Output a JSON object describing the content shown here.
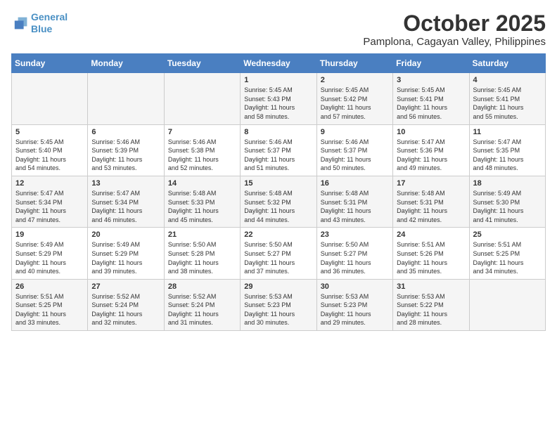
{
  "logo": {
    "line1": "General",
    "line2": "Blue"
  },
  "title": "October 2025",
  "location": "Pamplona, Cagayan Valley, Philippines",
  "weekdays": [
    "Sunday",
    "Monday",
    "Tuesday",
    "Wednesday",
    "Thursday",
    "Friday",
    "Saturday"
  ],
  "weeks": [
    [
      {
        "day": "",
        "info": ""
      },
      {
        "day": "",
        "info": ""
      },
      {
        "day": "",
        "info": ""
      },
      {
        "day": "1",
        "info": "Sunrise: 5:45 AM\nSunset: 5:43 PM\nDaylight: 11 hours\nand 58 minutes."
      },
      {
        "day": "2",
        "info": "Sunrise: 5:45 AM\nSunset: 5:42 PM\nDaylight: 11 hours\nand 57 minutes."
      },
      {
        "day": "3",
        "info": "Sunrise: 5:45 AM\nSunset: 5:41 PM\nDaylight: 11 hours\nand 56 minutes."
      },
      {
        "day": "4",
        "info": "Sunrise: 5:45 AM\nSunset: 5:41 PM\nDaylight: 11 hours\nand 55 minutes."
      }
    ],
    [
      {
        "day": "5",
        "info": "Sunrise: 5:45 AM\nSunset: 5:40 PM\nDaylight: 11 hours\nand 54 minutes."
      },
      {
        "day": "6",
        "info": "Sunrise: 5:46 AM\nSunset: 5:39 PM\nDaylight: 11 hours\nand 53 minutes."
      },
      {
        "day": "7",
        "info": "Sunrise: 5:46 AM\nSunset: 5:38 PM\nDaylight: 11 hours\nand 52 minutes."
      },
      {
        "day": "8",
        "info": "Sunrise: 5:46 AM\nSunset: 5:37 PM\nDaylight: 11 hours\nand 51 minutes."
      },
      {
        "day": "9",
        "info": "Sunrise: 5:46 AM\nSunset: 5:37 PM\nDaylight: 11 hours\nand 50 minutes."
      },
      {
        "day": "10",
        "info": "Sunrise: 5:47 AM\nSunset: 5:36 PM\nDaylight: 11 hours\nand 49 minutes."
      },
      {
        "day": "11",
        "info": "Sunrise: 5:47 AM\nSunset: 5:35 PM\nDaylight: 11 hours\nand 48 minutes."
      }
    ],
    [
      {
        "day": "12",
        "info": "Sunrise: 5:47 AM\nSunset: 5:34 PM\nDaylight: 11 hours\nand 47 minutes."
      },
      {
        "day": "13",
        "info": "Sunrise: 5:47 AM\nSunset: 5:34 PM\nDaylight: 11 hours\nand 46 minutes."
      },
      {
        "day": "14",
        "info": "Sunrise: 5:48 AM\nSunset: 5:33 PM\nDaylight: 11 hours\nand 45 minutes."
      },
      {
        "day": "15",
        "info": "Sunrise: 5:48 AM\nSunset: 5:32 PM\nDaylight: 11 hours\nand 44 minutes."
      },
      {
        "day": "16",
        "info": "Sunrise: 5:48 AM\nSunset: 5:31 PM\nDaylight: 11 hours\nand 43 minutes."
      },
      {
        "day": "17",
        "info": "Sunrise: 5:48 AM\nSunset: 5:31 PM\nDaylight: 11 hours\nand 42 minutes."
      },
      {
        "day": "18",
        "info": "Sunrise: 5:49 AM\nSunset: 5:30 PM\nDaylight: 11 hours\nand 41 minutes."
      }
    ],
    [
      {
        "day": "19",
        "info": "Sunrise: 5:49 AM\nSunset: 5:29 PM\nDaylight: 11 hours\nand 40 minutes."
      },
      {
        "day": "20",
        "info": "Sunrise: 5:49 AM\nSunset: 5:29 PM\nDaylight: 11 hours\nand 39 minutes."
      },
      {
        "day": "21",
        "info": "Sunrise: 5:50 AM\nSunset: 5:28 PM\nDaylight: 11 hours\nand 38 minutes."
      },
      {
        "day": "22",
        "info": "Sunrise: 5:50 AM\nSunset: 5:27 PM\nDaylight: 11 hours\nand 37 minutes."
      },
      {
        "day": "23",
        "info": "Sunrise: 5:50 AM\nSunset: 5:27 PM\nDaylight: 11 hours\nand 36 minutes."
      },
      {
        "day": "24",
        "info": "Sunrise: 5:51 AM\nSunset: 5:26 PM\nDaylight: 11 hours\nand 35 minutes."
      },
      {
        "day": "25",
        "info": "Sunrise: 5:51 AM\nSunset: 5:25 PM\nDaylight: 11 hours\nand 34 minutes."
      }
    ],
    [
      {
        "day": "26",
        "info": "Sunrise: 5:51 AM\nSunset: 5:25 PM\nDaylight: 11 hours\nand 33 minutes."
      },
      {
        "day": "27",
        "info": "Sunrise: 5:52 AM\nSunset: 5:24 PM\nDaylight: 11 hours\nand 32 minutes."
      },
      {
        "day": "28",
        "info": "Sunrise: 5:52 AM\nSunset: 5:24 PM\nDaylight: 11 hours\nand 31 minutes."
      },
      {
        "day": "29",
        "info": "Sunrise: 5:53 AM\nSunset: 5:23 PM\nDaylight: 11 hours\nand 30 minutes."
      },
      {
        "day": "30",
        "info": "Sunrise: 5:53 AM\nSunset: 5:23 PM\nDaylight: 11 hours\nand 29 minutes."
      },
      {
        "day": "31",
        "info": "Sunrise: 5:53 AM\nSunset: 5:22 PM\nDaylight: 11 hours\nand 28 minutes."
      },
      {
        "day": "",
        "info": ""
      }
    ]
  ]
}
